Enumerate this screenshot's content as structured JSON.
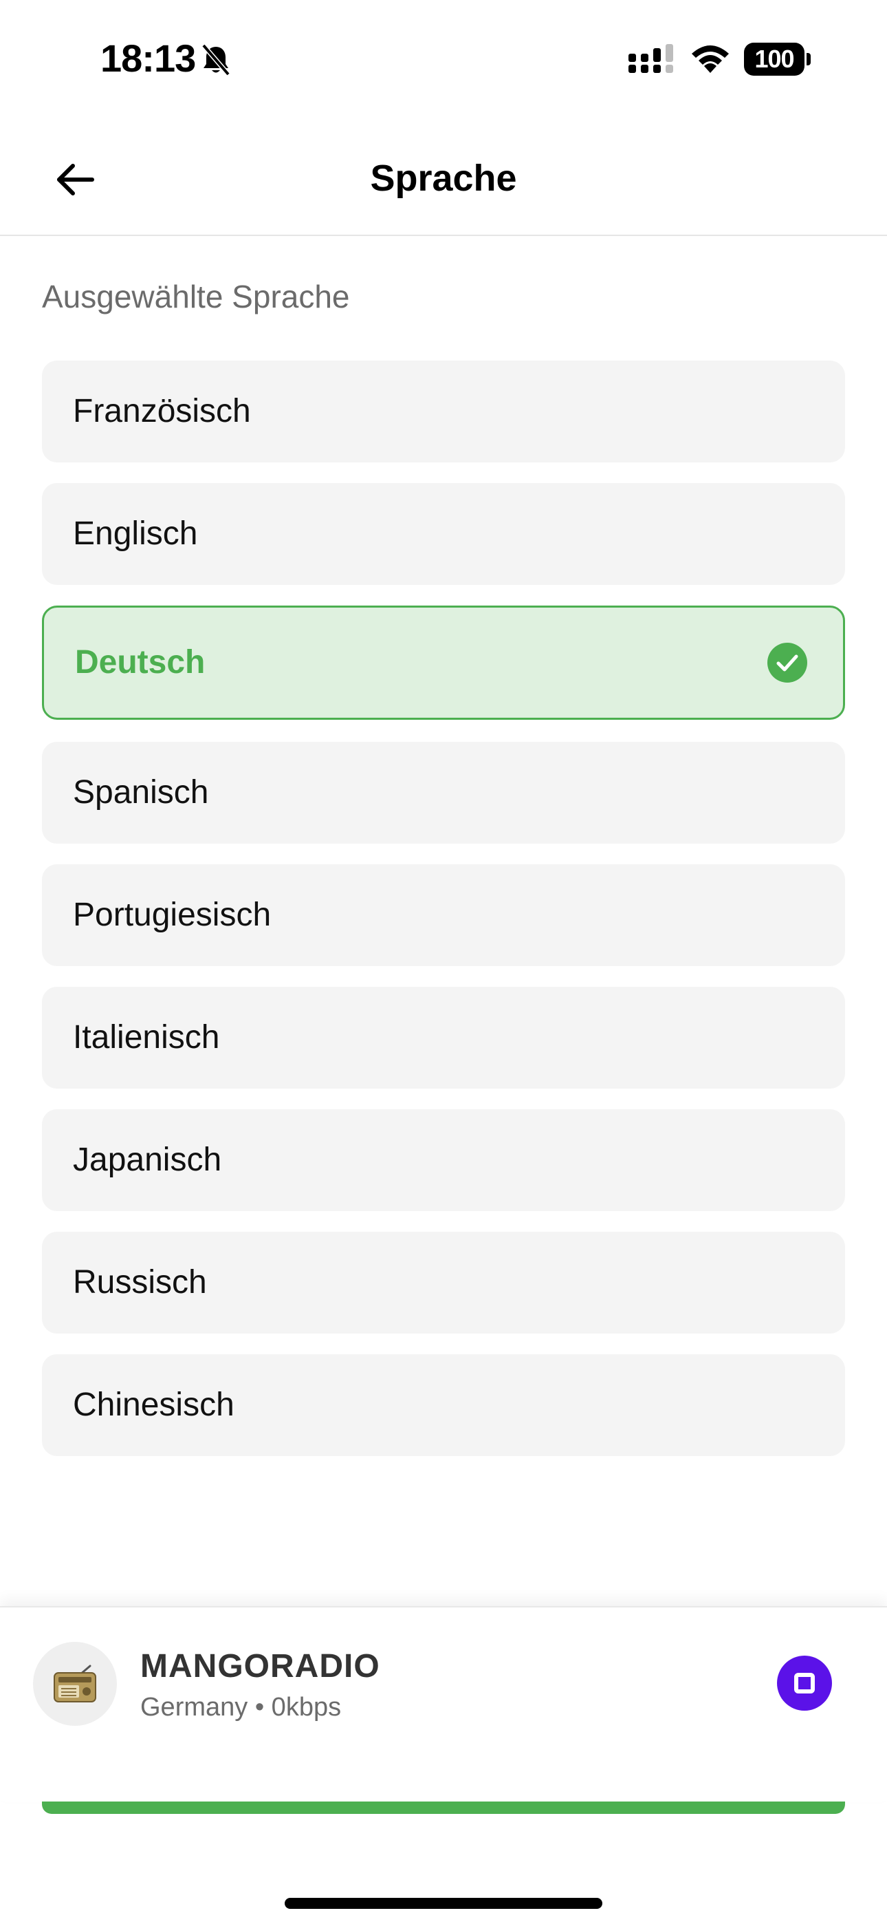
{
  "status_bar": {
    "time": "18:13",
    "battery": "100",
    "icons": [
      "bell-slash-icon",
      "signal-icon",
      "wifi-icon",
      "battery-icon"
    ]
  },
  "header": {
    "title": "Sprache",
    "back_icon": "arrow-left-icon"
  },
  "section": {
    "label": "Ausgewählte Sprache"
  },
  "languages": [
    {
      "label": "Französisch",
      "selected": false
    },
    {
      "label": "Englisch",
      "selected": false
    },
    {
      "label": "Deutsch",
      "selected": true
    },
    {
      "label": "Spanisch",
      "selected": false
    },
    {
      "label": "Portugiesisch",
      "selected": false
    },
    {
      "label": "Italienisch",
      "selected": false
    },
    {
      "label": "Japanisch",
      "selected": false
    },
    {
      "label": "Russisch",
      "selected": false
    },
    {
      "label": "Chinesisch",
      "selected": false
    }
  ],
  "player": {
    "station_name": "MANGORADIO",
    "station_meta": "Germany • 0kbps",
    "avatar_icon": "radio-icon",
    "action_icon": "stop-icon"
  },
  "colors": {
    "accent_green": "#4caf50",
    "selected_bg": "#dff1df",
    "stop_button": "#5b12e8",
    "item_bg": "#f4f4f4"
  }
}
